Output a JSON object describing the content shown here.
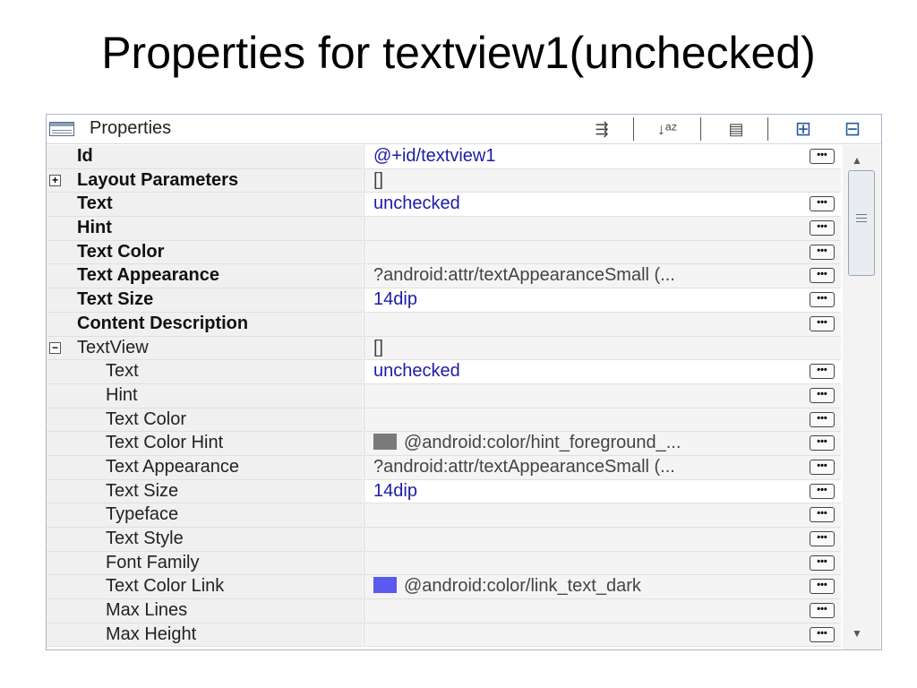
{
  "slide": {
    "title": "Properties for textview1(unchecked)"
  },
  "panel": {
    "title": "Properties",
    "toolbar": [
      {
        "name": "show-advanced-icon",
        "glyph": "⇶"
      },
      {
        "name": "sort-alphabetical-icon",
        "glyph": "↓ᵃᶻ"
      },
      {
        "name": "restore-defaults-icon",
        "glyph": "▤"
      },
      {
        "name": "expand-all-icon",
        "glyph": "⊞"
      },
      {
        "name": "collapse-all-icon",
        "glyph": "⊟"
      }
    ]
  },
  "rows": [
    {
      "name": "Id",
      "value": "@+id/textview1"
    },
    {
      "name": "Layout Parameters",
      "value": "[]",
      "expander": "+"
    },
    {
      "name": "Text",
      "value": "unchecked"
    },
    {
      "name": "Hint",
      "value": ""
    },
    {
      "name": "Text Color",
      "value": ""
    },
    {
      "name": "Text Appearance",
      "value": "?android:attr/textAppearanceSmall (..."
    },
    {
      "name": "Text Size",
      "value": "14dip"
    },
    {
      "name": "Content Description",
      "value": ""
    },
    {
      "name": "TextView",
      "value": "[]",
      "expander": "−"
    },
    {
      "name": "Text",
      "value": "unchecked"
    },
    {
      "name": "Hint",
      "value": ""
    },
    {
      "name": "Text Color",
      "value": ""
    },
    {
      "name": "Text Color Hint",
      "value": "@android:color/hint_foreground_...",
      "swatch": "#7a7a7a"
    },
    {
      "name": "Text Appearance",
      "value": "?android:attr/textAppearanceSmall (..."
    },
    {
      "name": "Text Size",
      "value": "14dip"
    },
    {
      "name": "Typeface",
      "value": ""
    },
    {
      "name": "Text Style",
      "value": ""
    },
    {
      "name": "Font Family",
      "value": ""
    },
    {
      "name": "Text Color Link",
      "value": "@android:color/link_text_dark",
      "swatch": "#5a5aee"
    },
    {
      "name": "Max Lines",
      "value": ""
    },
    {
      "name": "Max Height",
      "value": ""
    }
  ],
  "ellipsis_label": "•••",
  "colors": {
    "value_blue": "#1c1ca8",
    "border": "#a9b6c8"
  }
}
